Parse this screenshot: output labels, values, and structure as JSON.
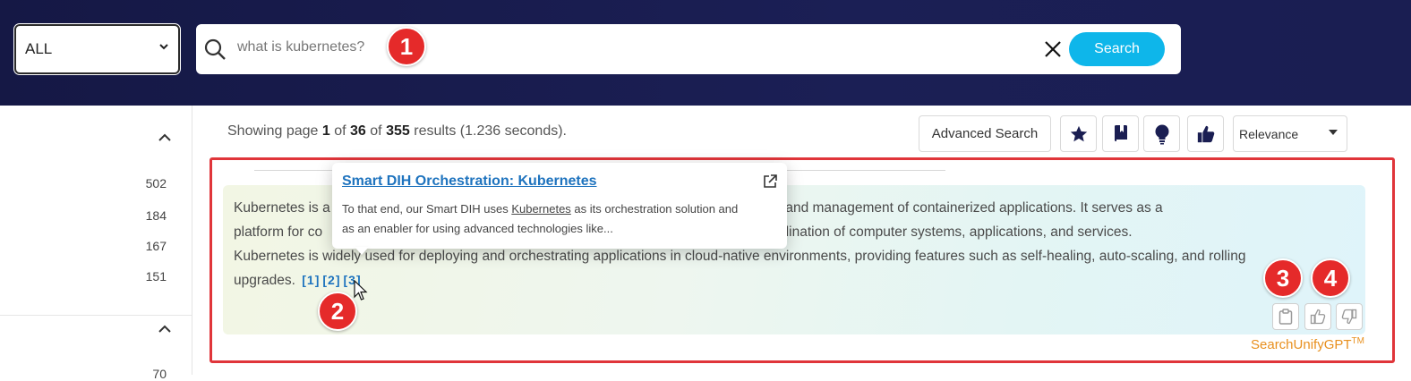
{
  "header": {
    "scope_select": {
      "selected": "ALL"
    },
    "search": {
      "value": "what is kubernetes?",
      "button_label": "Search"
    }
  },
  "annotations": {
    "badge1": "1",
    "badge2": "2",
    "badge3": "3",
    "badge4": "4"
  },
  "sidebar": {
    "counts": [
      "502",
      "184",
      "167",
      "151",
      "70"
    ]
  },
  "results": {
    "prefix": "Showing page",
    "page": "1",
    "of1": "of",
    "total_pages": "36",
    "of2": "of",
    "total_results": "355",
    "suffix": "results (1.236 seconds)."
  },
  "toolbar": {
    "advanced_search_label": "Advanced Search",
    "icons": [
      "star-icon",
      "bookmark-book-icon",
      "lightbulb-icon",
      "thumbs-up-icon"
    ],
    "sort": {
      "selected": "Relevance"
    }
  },
  "answer": {
    "line1_a": "Kubernetes is a",
    "line1_b": "deployment, scaling, and management of containerized applications. It serves as a",
    "line2_a": "platform for co",
    "line2_b": "anagement, and coordination of computer systems, applications, and services.",
    "line3": "Kubernetes is widely used for deploying and orchestrating applications in cloud-native environments, providing features such as self-healing, auto-scaling, and rolling",
    "line4": "upgrades.",
    "citations": [
      "[1]",
      "[2]",
      "[3]"
    ],
    "brand": "SearchUnifyGPT",
    "trademark": "TM"
  },
  "popup": {
    "title": "Smart DIH Orchestration: Kubernetes",
    "body_pre": "To that end, our Smart DIH uses ",
    "body_highlight": "Kubernetes",
    "body_post": " as its orchestration solution and as an enabler for using advanced technologies like..."
  },
  "colors": {
    "header_bg": "#151845",
    "accent": "#0eb6ea",
    "annotation_red": "#e52a2a",
    "link_blue": "#1e73be",
    "brand_orange": "#e8901f"
  }
}
